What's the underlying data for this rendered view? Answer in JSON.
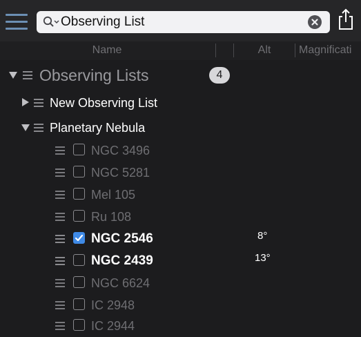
{
  "toolbar": {
    "search_value": "Observing List"
  },
  "columns": {
    "name": "Name",
    "alt": "Alt",
    "magnification": "Magnificati"
  },
  "root": {
    "label": "Observing Lists",
    "count": "4"
  },
  "groups": {
    "new_list": "New Observing List",
    "planetary": "Planetary Nebula"
  },
  "objects": [
    {
      "name": "NGC 3496",
      "checked": false,
      "alt": ""
    },
    {
      "name": "NGC 5281",
      "checked": false,
      "alt": ""
    },
    {
      "name": "Mel 105",
      "checked": false,
      "alt": ""
    },
    {
      "name": "Ru 108",
      "checked": false,
      "alt": ""
    },
    {
      "name": "NGC 2546",
      "checked": true,
      "alt": "8°"
    },
    {
      "name": "NGC 2439",
      "checked": false,
      "alt": "13°"
    },
    {
      "name": "NGC 6624",
      "checked": false,
      "alt": ""
    },
    {
      "name": "IC 2948",
      "checked": false,
      "alt": ""
    },
    {
      "name": "IC 2944",
      "checked": false,
      "alt": ""
    }
  ],
  "colors": {
    "background": "#1c1c1e",
    "accent": "#6c8fb4",
    "checkbox_checked": "#3f8ae6",
    "dim_text": "#6e6e72",
    "bright_text": "#ffffff"
  }
}
